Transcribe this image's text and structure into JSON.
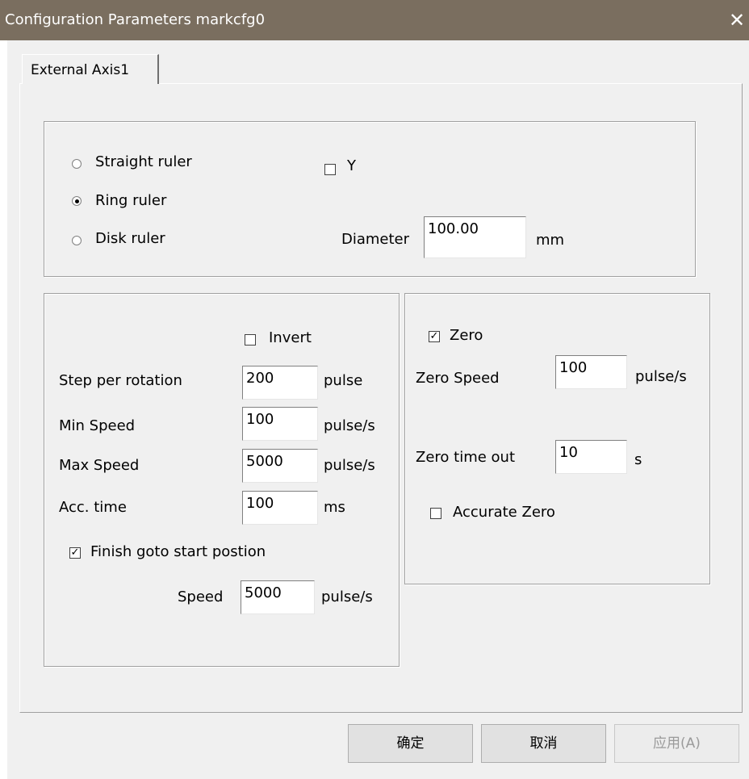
{
  "window": {
    "title": "Configuration Parameters markcfg0",
    "close_glyph": "✕"
  },
  "tabs": [
    {
      "label": "External Axis1",
      "active": true
    }
  ],
  "ruler_group": {
    "options": [
      {
        "label": "Straight ruler",
        "selected": false
      },
      {
        "label": "Ring ruler",
        "selected": true
      },
      {
        "label": "Disk ruler",
        "selected": false
      }
    ],
    "y_checkbox": {
      "label": "Y",
      "checked": false
    },
    "diameter": {
      "label": "Diameter",
      "value": "100.00",
      "unit": "mm"
    }
  },
  "motion_group": {
    "invert": {
      "label": "Invert",
      "checked": false
    },
    "step_per_rotation": {
      "label": "Step per rotation",
      "value": "200",
      "unit": "pulse"
    },
    "min_speed": {
      "label": "Min Speed",
      "value": "100",
      "unit": "pulse/s"
    },
    "max_speed": {
      "label": "Max Speed",
      "value": "5000",
      "unit": "pulse/s"
    },
    "acc_time": {
      "label": "Acc. time",
      "value": "100",
      "unit": "ms"
    },
    "finish_goto_start": {
      "label": "Finish goto start postion",
      "checked": true
    },
    "speed": {
      "label": "Speed",
      "value": "5000",
      "unit": "pulse/s"
    }
  },
  "zero_group": {
    "zero": {
      "label": "Zero",
      "checked": true
    },
    "zero_speed": {
      "label": "Zero Speed",
      "value": "100",
      "unit": "pulse/s"
    },
    "zero_timeout": {
      "label": "Zero time out",
      "value": "10",
      "unit": "s"
    },
    "accurate_zero": {
      "label": "Accurate Zero",
      "checked": false
    }
  },
  "buttons": {
    "ok": "确定",
    "cancel": "取消",
    "apply": "应用(A)"
  },
  "glyphs": {
    "check_mark": "✓"
  },
  "colors": {
    "titlebar": "#7a6e5f",
    "dialog_bg": "#f0f0f0",
    "field_bg": "#ffffff"
  }
}
